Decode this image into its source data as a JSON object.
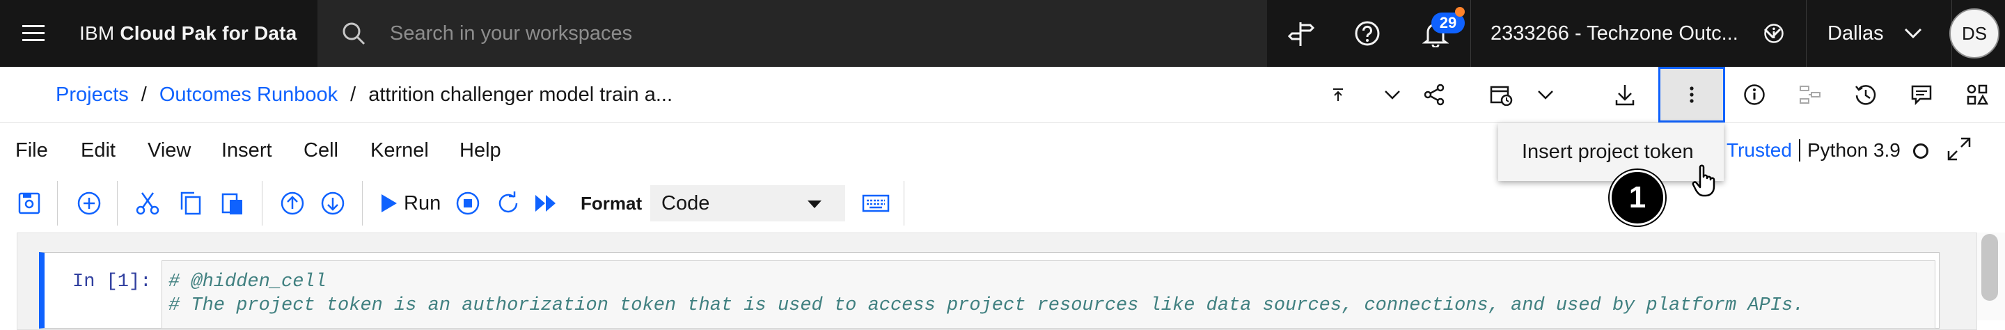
{
  "topbar": {
    "brand_prefix": "IBM",
    "brand_name": "Cloud Pak for Data",
    "search_placeholder": "Search in your workspaces",
    "notification_count": "29",
    "account": "2333266 - Techzone Outc...",
    "region": "Dallas",
    "avatar_initials": "DS",
    "badge_color": "#0f62fe",
    "alert_dot_color": "#ff832b"
  },
  "breadcrumb": {
    "items": [
      "Projects",
      "Outcomes Runbook"
    ],
    "separator": "/",
    "current": "attrition challenger model train a..."
  },
  "menubar": {
    "items": [
      "File",
      "Edit",
      "View",
      "Insert",
      "Cell",
      "Kernel",
      "Help"
    ],
    "trusted": "Trusted",
    "kernel": "Python 3.9"
  },
  "dropdown": {
    "item": "Insert project token"
  },
  "step_marker": "1",
  "toolbar": {
    "run_label": "Run",
    "format_label": "Format",
    "format_value": "Code"
  },
  "cell": {
    "prompt": "In [1]:",
    "lines": [
      "# @hidden_cell",
      "# The project token is an authorization token that is used to access project resources like data sources, connections, and used by platform APIs."
    ]
  },
  "accent_color": "#0f62fe"
}
